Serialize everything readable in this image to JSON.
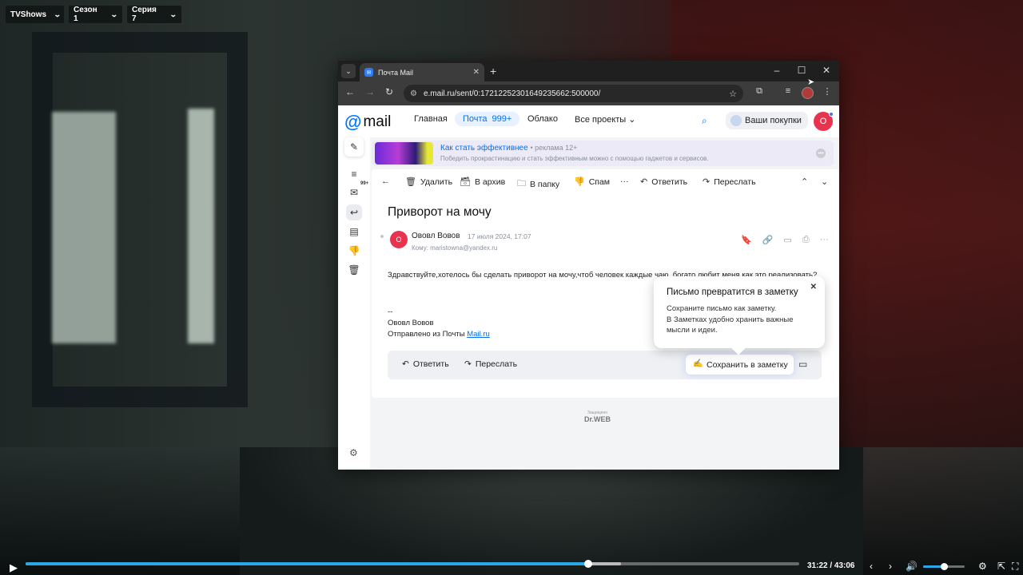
{
  "player": {
    "show_selector": "TVShows",
    "season_selector": "Сезон 1",
    "episode_selector": "Серия 7",
    "current_time": "31:22",
    "time_separator": "/",
    "duration": "43:06",
    "progress_fraction": 0.727,
    "buffer_fraction": 0.77,
    "volume_fraction": 0.5
  },
  "browser": {
    "tab_title": "Почта Mail",
    "url": "e.mail.ru/sent/0:17212252301649235662:500000/"
  },
  "mail": {
    "logo_text": "mail",
    "nav": {
      "home": "Главная",
      "mail": "Почта",
      "mail_count": "999+",
      "cloud": "Облако",
      "all_projects": "Все проекты"
    },
    "purchases": "Ваши покупки",
    "user_initial": "О",
    "sidebar_badge": "99+",
    "ad": {
      "title": "Как стать эффективнее",
      "mark": "• реклама 12+",
      "text": "Победить прокрастинацию и стать эффективным можно с помощью гаджетов и сервисов."
    },
    "actions": {
      "delete": "Удалить",
      "archive": "В архив",
      "folder": "В папку",
      "spam": "Спам",
      "more": "···",
      "reply": "Ответить",
      "forward": "Переслать"
    },
    "letter": {
      "subject": "Приворот на мочу",
      "sender_initial": "О",
      "sender_name": "Ововл Вовов",
      "date": "17 июля 2024, 17:07",
      "to": "Кому: maristowna@yandex.ru",
      "body": "Здравствуйте,хотелось бы сделать приворот на мочу,чтоб человек каждые чаю, богато любит меня как это реализовать?",
      "sig_dash": "--",
      "sig_name": "Ововл Вовов",
      "sig_sent": "Отправлено из Почты",
      "sig_link": "Mail.ru"
    },
    "reply_bar": {
      "reply": "Ответить",
      "forward": "Переслать",
      "save_note": "Сохранить в заметку"
    },
    "tooltip": {
      "title": "Письмо превратится в заметку",
      "line1": "Сохраните письмо как заметку.",
      "line2": "В Заметках удобно хранить важные мысли и идеи."
    },
    "drweb_small": "Защищено",
    "drweb_brand": "Dr.WEB"
  }
}
